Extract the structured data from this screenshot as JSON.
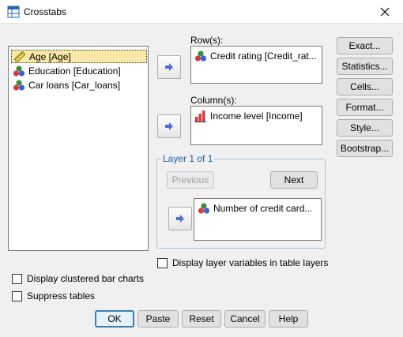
{
  "window": {
    "title": "Crosstabs"
  },
  "variables": [
    {
      "label": "Age [Age]",
      "icon": "ruler-icon"
    },
    {
      "label": "Education [Education]",
      "icon": "nominal-icon"
    },
    {
      "label": "Car loans [Car_loans]",
      "icon": "nominal-icon"
    }
  ],
  "rows": {
    "heading": "Row(s):",
    "item": "Credit rating [Credit_rat..."
  },
  "columns": {
    "heading": "Column(s):",
    "item": "Income level [Income]"
  },
  "layer": {
    "heading": "Layer 1 of 1",
    "previous_label": "Previous",
    "next_label": "Next",
    "item": "Number of credit card..."
  },
  "side_buttons": [
    "Exact...",
    "Statistics...",
    "Cells...",
    "Format...",
    "Style...",
    "Bootstrap..."
  ],
  "checkboxes": {
    "display_layer": "Display layer variables in table layers",
    "clustered": "Display clustered bar charts",
    "suppress": "Suppress tables"
  },
  "footer": {
    "ok": "OK",
    "paste": "Paste",
    "reset": "Reset",
    "cancel": "Cancel",
    "help": "Help"
  },
  "colors": {
    "selection": "#f9e8a6",
    "layer_heading": "#1e5b9c",
    "arrow": "#4a6fd0"
  }
}
